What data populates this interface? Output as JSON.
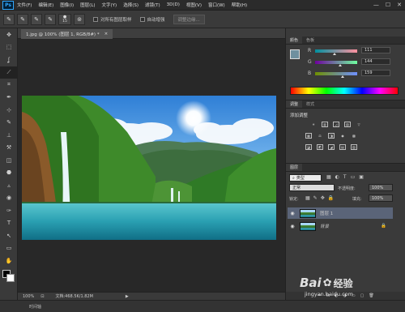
{
  "app": {
    "logo": "Ps"
  },
  "menubar": {
    "items": [
      "文件(F)",
      "编辑(E)",
      "图像(I)",
      "图层(L)",
      "文字(Y)",
      "选择(S)",
      "滤镜(T)",
      "3D(D)",
      "视图(V)",
      "窗口(W)",
      "帮助(H)"
    ],
    "window_controls": [
      "—",
      "☐",
      "✕"
    ]
  },
  "options": {
    "brush_size": "15",
    "sample_all": "对所有图层取样",
    "auto_enhance": "自动增强",
    "refine_edge": "调整边缘..."
  },
  "document": {
    "tab_title": "1.jpg @ 100% (图层 1, RGB/8#) *",
    "close": "×"
  },
  "status": {
    "zoom": "100%",
    "doc_size": "文档:468.5K/1.82M",
    "arrow": "▶"
  },
  "timeline": {
    "label": "时间轴"
  },
  "color_panel": {
    "tabs": [
      "颜色",
      "色板"
    ],
    "r_label": "R",
    "g_label": "G",
    "b_label": "B",
    "r": "111",
    "g": "144",
    "b": "159",
    "fg_color": "#6f909f"
  },
  "adjustments_panel": {
    "tabs": [
      "调整",
      "样式"
    ],
    "heading": "添加调整",
    "row1": [
      "☀",
      "▥",
      "◿",
      "▧",
      "▽"
    ],
    "row2": [
      "▦",
      "⚖",
      "◨",
      "◉",
      "▩"
    ],
    "row3": [
      "◪",
      "◩",
      "◢",
      "▤",
      "▨"
    ]
  },
  "layers_panel": {
    "tabs": [
      "图层"
    ],
    "kind": "类型",
    "blend": "正常",
    "opacity_label": "不透明度:",
    "opacity": "100%",
    "lock_label": "锁定:",
    "fill_label": "填充:",
    "fill": "100%",
    "layers": [
      {
        "name": "图层 1",
        "selected": true
      },
      {
        "name": "背景",
        "selected": false
      }
    ],
    "bottom_icons": [
      "⚯",
      "fx",
      "◐",
      "◑",
      "▭",
      "▢",
      "🗑"
    ]
  },
  "watermark": {
    "brand": "Bai",
    "brand2": "经验",
    "url": "jingyan.baidu.com"
  },
  "tools": [
    "✥",
    "⬚",
    "ʆ",
    "⟋",
    "⌗",
    "✒",
    "⊹",
    "✎",
    "⊥",
    "⚒",
    "◫",
    "⬣",
    "▵",
    "◉",
    "✑",
    "T",
    "↖",
    "▭",
    "✋",
    "⌕"
  ]
}
